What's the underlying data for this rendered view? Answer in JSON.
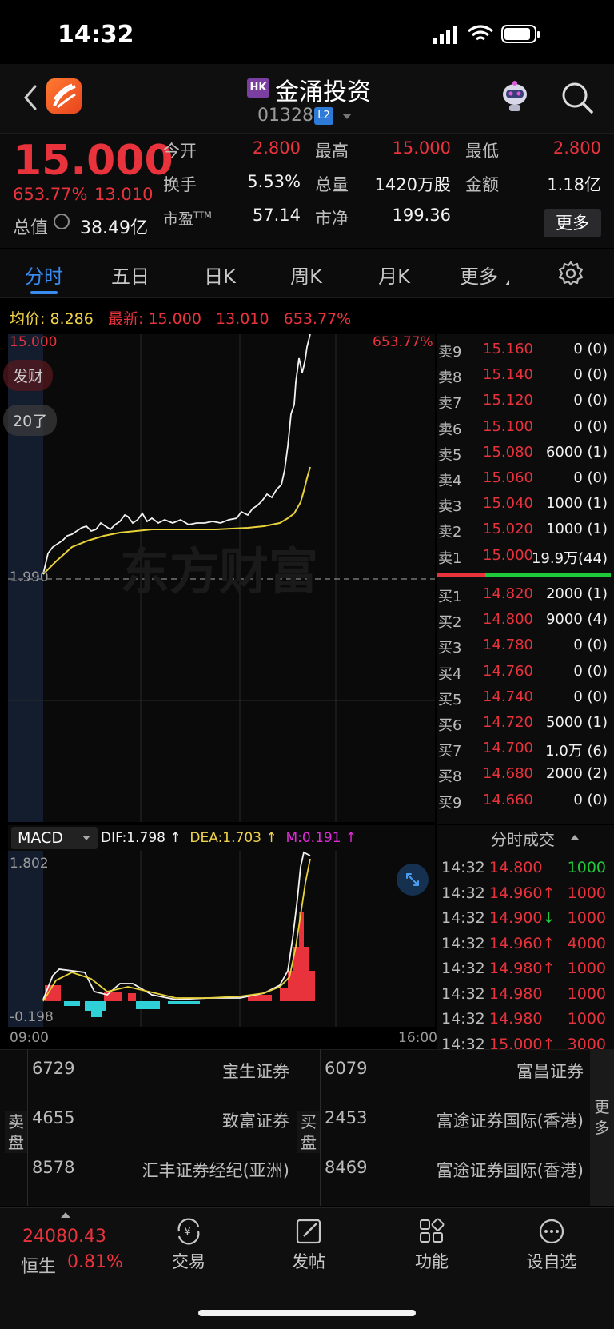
{
  "status": {
    "time": "14:32"
  },
  "header": {
    "market_badge": "HK",
    "name": "金涌投资",
    "code": "01328",
    "level_badge": "L2"
  },
  "quote": {
    "price": "15.000",
    "change_pct": "653.77%",
    "change_amt": "13.010",
    "total_value_label": "总值",
    "total_value": "38.49亿",
    "open_label": "今开",
    "open": "2.800",
    "high_label": "最高",
    "high": "15.000",
    "low_label": "最低",
    "low": "2.800",
    "turnover_label": "换手",
    "turnover": "5.53%",
    "volume_label": "总量",
    "volume": "1420万股",
    "amount_label": "金额",
    "amount": "1.18亿",
    "pe_label": "市盈",
    "pe_sup": "TTM",
    "pe": "57.14",
    "pb_label": "市净",
    "pb": "199.36",
    "more_label": "更多"
  },
  "tabs": [
    "分时",
    "五日",
    "日K",
    "周K",
    "月K",
    "更多"
  ],
  "info_line": {
    "avg_label": "均价:",
    "avg": "8.286",
    "latest_label": "最新:",
    "latest": "15.000",
    "change": "13.010",
    "pct": "653.77%"
  },
  "chart": {
    "top_price": "15.000",
    "top_pct": "653.77%",
    "mid_price": "1.990",
    "float_1": "发财",
    "float_2": "20了",
    "watermark": "东方财富",
    "time_start": "09:00",
    "time_end": "16:00"
  },
  "order_book": {
    "asks": [
      {
        "label": "卖9",
        "price": "15.160",
        "vol": "0 (0)"
      },
      {
        "label": "卖8",
        "price": "15.140",
        "vol": "0 (0)"
      },
      {
        "label": "卖7",
        "price": "15.120",
        "vol": "0 (0)"
      },
      {
        "label": "卖6",
        "price": "15.100",
        "vol": "0 (0)"
      },
      {
        "label": "卖5",
        "price": "15.080",
        "vol": "6000 (1)"
      },
      {
        "label": "卖4",
        "price": "15.060",
        "vol": "0 (0)"
      },
      {
        "label": "卖3",
        "price": "15.040",
        "vol": "1000 (1)"
      },
      {
        "label": "卖2",
        "price": "15.020",
        "vol": "1000 (1)"
      },
      {
        "label": "卖1",
        "price": "15.000",
        "vol": "19.9万(44)"
      }
    ],
    "bids": [
      {
        "label": "买1",
        "price": "14.820",
        "vol": "2000 (1)"
      },
      {
        "label": "买2",
        "price": "14.800",
        "vol": "9000 (4)"
      },
      {
        "label": "买3",
        "price": "14.780",
        "vol": "0 (0)"
      },
      {
        "label": "买4",
        "price": "14.760",
        "vol": "0 (0)"
      },
      {
        "label": "买5",
        "price": "14.740",
        "vol": "0 (0)"
      },
      {
        "label": "买6",
        "price": "14.720",
        "vol": "5000 (1)"
      },
      {
        "label": "买7",
        "price": "14.700",
        "vol": "1.0万 (6)"
      },
      {
        "label": "买8",
        "price": "14.680",
        "vol": "2000 (2)"
      },
      {
        "label": "买9",
        "price": "14.660",
        "vol": "0 (0)"
      }
    ]
  },
  "macd": {
    "selector": "MACD",
    "dif": "DIF:1.798 ↑",
    "dea": "DEA:1.703 ↑",
    "m": "M:0.191 ↑",
    "top": "1.802",
    "bottom": "-0.198"
  },
  "ticks": {
    "header": "分时成交",
    "rows": [
      {
        "time": "14:32",
        "price": "14.800",
        "dir": "",
        "amt": "1000",
        "amt_color": "#1fc93a"
      },
      {
        "time": "14:32",
        "price": "14.960",
        "dir": "↑",
        "amt": "1000",
        "amt_color": "#e8323c"
      },
      {
        "time": "14:32",
        "price": "14.900",
        "dir": "↓",
        "amt": "1000",
        "amt_color": "#e8323c"
      },
      {
        "time": "14:32",
        "price": "14.960",
        "dir": "↑",
        "amt": "4000",
        "amt_color": "#e8323c"
      },
      {
        "time": "14:32",
        "price": "14.980",
        "dir": "↑",
        "amt": "1000",
        "amt_color": "#e8323c"
      },
      {
        "time": "14:32",
        "price": "14.980",
        "dir": "",
        "amt": "1000",
        "amt_color": "#e8323c"
      },
      {
        "time": "14:32",
        "price": "14.980",
        "dir": "",
        "amt": "1000",
        "amt_color": "#e8323c"
      },
      {
        "time": "14:32",
        "price": "15.000",
        "dir": "↑",
        "amt": "3000",
        "amt_color": "#e8323c"
      }
    ]
  },
  "brokers": {
    "sell_label": "卖盘",
    "buy_label": "买盘",
    "more_label": "更多",
    "sell": [
      {
        "id": "6729",
        "name": "宝生证券"
      },
      {
        "id": "4655",
        "name": "致富证券"
      },
      {
        "id": "8578",
        "name": "汇丰证券经纪(亚洲)"
      }
    ],
    "buy": [
      {
        "id": "6079",
        "name": "富昌证券"
      },
      {
        "id": "2453",
        "name": "富途证券国际(香港)"
      },
      {
        "id": "8469",
        "name": "富途证券国际(香港)"
      }
    ]
  },
  "bottom": {
    "index_value": "24080.43",
    "index_name": "恒生",
    "index_pct": "0.81%",
    "nav": [
      "交易",
      "发帖",
      "功能",
      "设自选"
    ]
  }
}
